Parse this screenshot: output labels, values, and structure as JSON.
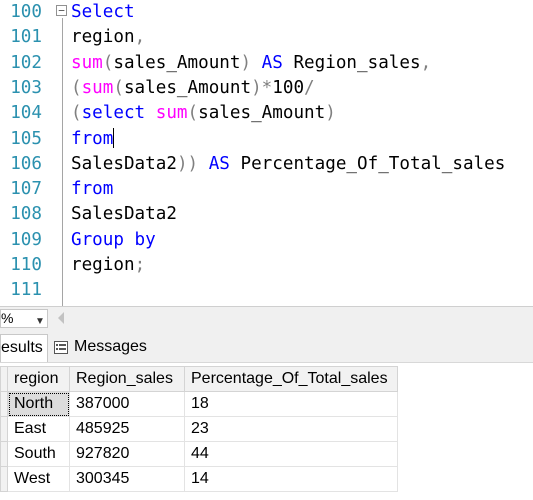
{
  "editor": {
    "lines": [
      {
        "num": "100",
        "code": [
          {
            "t": "Select",
            "c": "kw"
          }
        ]
      },
      {
        "num": "101",
        "code": [
          {
            "t": "region",
            "c": ""
          },
          {
            "t": ",",
            "c": "op"
          }
        ]
      },
      {
        "num": "102",
        "code": [
          {
            "t": "sum",
            "c": "fn"
          },
          {
            "t": "(",
            "c": "op"
          },
          {
            "t": "sales_Amount",
            "c": ""
          },
          {
            "t": ")",
            "c": "op"
          },
          {
            "t": " ",
            "c": ""
          },
          {
            "t": "AS",
            "c": "kw"
          },
          {
            "t": " Region_sales",
            "c": ""
          },
          {
            "t": ",",
            "c": "op"
          }
        ]
      },
      {
        "num": "103",
        "code": [
          {
            "t": "(",
            "c": "op"
          },
          {
            "t": "sum",
            "c": "fn"
          },
          {
            "t": "(",
            "c": "op"
          },
          {
            "t": "sales_Amount",
            "c": ""
          },
          {
            "t": ")*",
            "c": "op"
          },
          {
            "t": "100",
            "c": ""
          },
          {
            "t": "/",
            "c": "op"
          }
        ]
      },
      {
        "num": "104",
        "code": [
          {
            "t": "(",
            "c": "op"
          },
          {
            "t": "select",
            "c": "kw"
          },
          {
            "t": " ",
            "c": ""
          },
          {
            "t": "sum",
            "c": "fn"
          },
          {
            "t": "(",
            "c": "op"
          },
          {
            "t": "sales_Amount",
            "c": ""
          },
          {
            "t": ")",
            "c": "op"
          }
        ]
      },
      {
        "num": "105",
        "code": [
          {
            "t": "from",
            "c": "kw"
          },
          {
            "t": "",
            "c": "caret"
          }
        ]
      },
      {
        "num": "106",
        "code": [
          {
            "t": "SalesData2",
            "c": ""
          },
          {
            "t": "))",
            "c": "op"
          },
          {
            "t": " ",
            "c": ""
          },
          {
            "t": "AS",
            "c": "kw"
          },
          {
            "t": " Percentage_Of_Total_sales",
            "c": ""
          }
        ]
      },
      {
        "num": "107",
        "code": [
          {
            "t": "from",
            "c": "kw"
          }
        ]
      },
      {
        "num": "108",
        "code": [
          {
            "t": "SalesData2",
            "c": ""
          }
        ]
      },
      {
        "num": "109",
        "code": [
          {
            "t": "Group by",
            "c": "kw"
          }
        ]
      },
      {
        "num": "110",
        "code": [
          {
            "t": "region",
            "c": ""
          },
          {
            "t": ";",
            "c": "op"
          }
        ]
      },
      {
        "num": "111",
        "code": []
      }
    ],
    "fold_glyph": "−"
  },
  "zoom": {
    "value": "%",
    "arrow": "▼"
  },
  "tabs": {
    "results": "esults",
    "messages": "Messages"
  },
  "grid": {
    "columns": [
      "region",
      "Region_sales",
      "Percentage_Of_Total_sales"
    ],
    "rows": [
      [
        "North",
        "387000",
        "18"
      ],
      [
        "East",
        "485925",
        "23"
      ],
      [
        "South",
        "927820",
        "44"
      ],
      [
        "West",
        "300345",
        "14"
      ]
    ]
  }
}
